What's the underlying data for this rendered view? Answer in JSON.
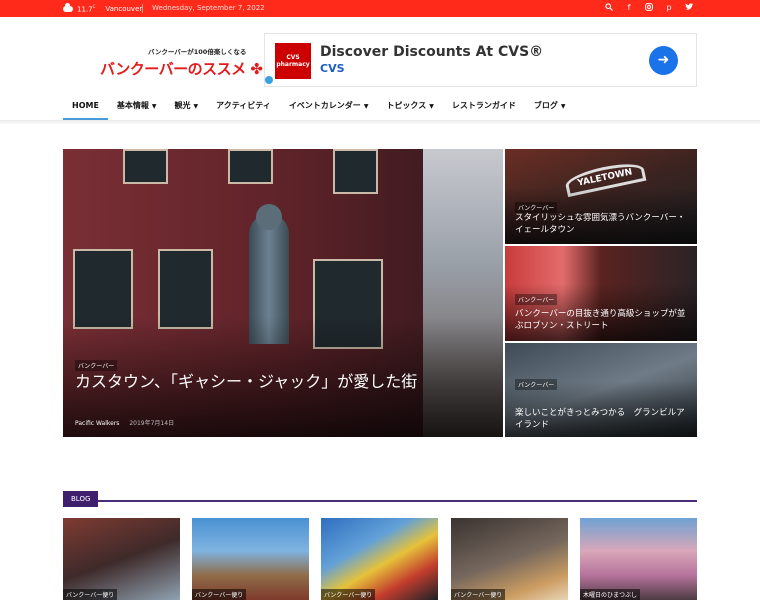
{
  "topbar": {
    "temperature": "11.7",
    "temp_unit": "C",
    "city": "Vancouver",
    "date": "Wednesday, September 7, 2022",
    "social_icons": [
      "search-icon",
      "facebook-icon",
      "instagram-icon",
      "pinterest-icon",
      "twitter-icon"
    ],
    "bg_color": "#ff2a1a"
  },
  "logo": {
    "tagline": "バンクーバーが100倍楽しくなる",
    "title": "バンクーバーのススメ"
  },
  "ad": {
    "logo_text": "CVS pharmacy",
    "headline": "Discover Discounts At CVS®",
    "brand": "CVS"
  },
  "nav": {
    "items": [
      {
        "label": "HOME",
        "dropdown": false
      },
      {
        "label": "基本情報",
        "dropdown": true
      },
      {
        "label": "観光",
        "dropdown": true
      },
      {
        "label": "アクティビティ",
        "dropdown": false
      },
      {
        "label": "イベントカレンダー",
        "dropdown": true
      },
      {
        "label": "トピックス",
        "dropdown": true
      },
      {
        "label": "レストランガイド",
        "dropdown": false
      },
      {
        "label": "ブログ",
        "dropdown": true
      }
    ]
  },
  "featured": {
    "main": {
      "category": "バンクーバー",
      "title": "カスタウン、「ギャシー・ジャック」が愛した街",
      "author": "Pacific Walkers",
      "date": "2019年7月14日"
    },
    "side": [
      {
        "category": "バンクーバー",
        "title": "スタイリッシュな雰囲気漂うバンクーバー・イェールタウン",
        "sign": "YALETOWN"
      },
      {
        "category": "バンクーバー",
        "title": "バンクーバーの目抜き通り高級ショップが並ぶロブソン・ストリート"
      },
      {
        "category": "バンクーバー",
        "title": "楽しいことがきっとみつかる　グランビルアイランド"
      }
    ]
  },
  "blog": {
    "section_label": "BLOG",
    "accent_color": "#3e1f6e",
    "thumbs": [
      {
        "caption": "バンクーバー便り"
      },
      {
        "caption": "バンクーバー便り"
      },
      {
        "caption": "バンクーバー便り"
      },
      {
        "caption": "バンクーバー便り"
      },
      {
        "caption": "木曜日のひまつぶし"
      }
    ]
  }
}
